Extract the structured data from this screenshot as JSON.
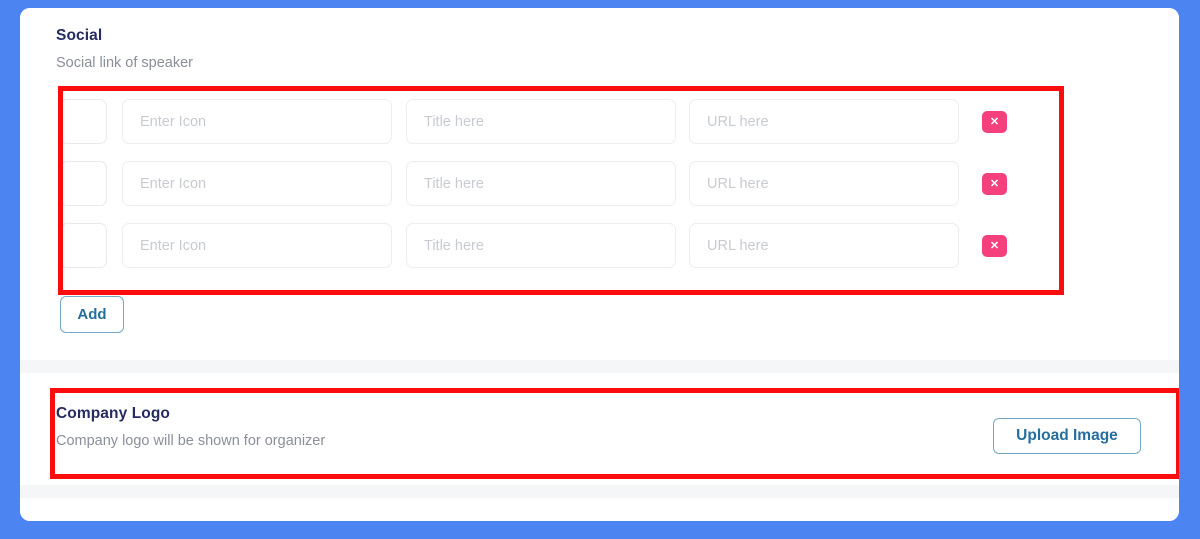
{
  "theme": {
    "page_background": "#4c85f2",
    "card_background": "#ffffff",
    "heading_color": "#262b61",
    "muted_text_color": "#8a8f9a",
    "placeholder_color": "#c8cbd2",
    "delete_button_color": "#f5407e",
    "outline_button_border": "#74a9c6",
    "outline_button_text": "#256f9f",
    "annotation_color": "#fb0d0d",
    "divider_strip_color": "#f5f6f8"
  },
  "social_section": {
    "title": "Social",
    "subtitle": "Social link of speaker",
    "add_button_label": "Add",
    "columns": {
      "icon_preview": "icon-preview",
      "icon": "Enter Icon",
      "title": "Title here",
      "url": "URL here"
    },
    "rows": [
      {
        "icon_placeholder": "Enter Icon",
        "icon_value": "",
        "title_placeholder": "Title here",
        "title_value": "",
        "url_placeholder": "URL here",
        "url_value": "",
        "delete_icon": "close-x-icon",
        "delete_glyph": "✕"
      },
      {
        "icon_placeholder": "Enter Icon",
        "icon_value": "",
        "title_placeholder": "Title here",
        "title_value": "",
        "url_placeholder": "URL here",
        "url_value": "",
        "delete_icon": "close-x-icon",
        "delete_glyph": "✕"
      },
      {
        "icon_placeholder": "Enter Icon",
        "icon_value": "",
        "title_placeholder": "Title here",
        "title_value": "",
        "url_placeholder": "URL here",
        "url_value": "",
        "delete_icon": "close-x-icon",
        "delete_glyph": "✕"
      }
    ]
  },
  "company_logo_section": {
    "title": "Company Logo",
    "subtitle": "Company logo will be shown for organizer",
    "upload_button_label": "Upload Image"
  },
  "annotations": [
    {
      "name": "social-rows-highlight",
      "target": "social rows block"
    },
    {
      "name": "company-logo-highlight",
      "target": "company logo section"
    }
  ]
}
